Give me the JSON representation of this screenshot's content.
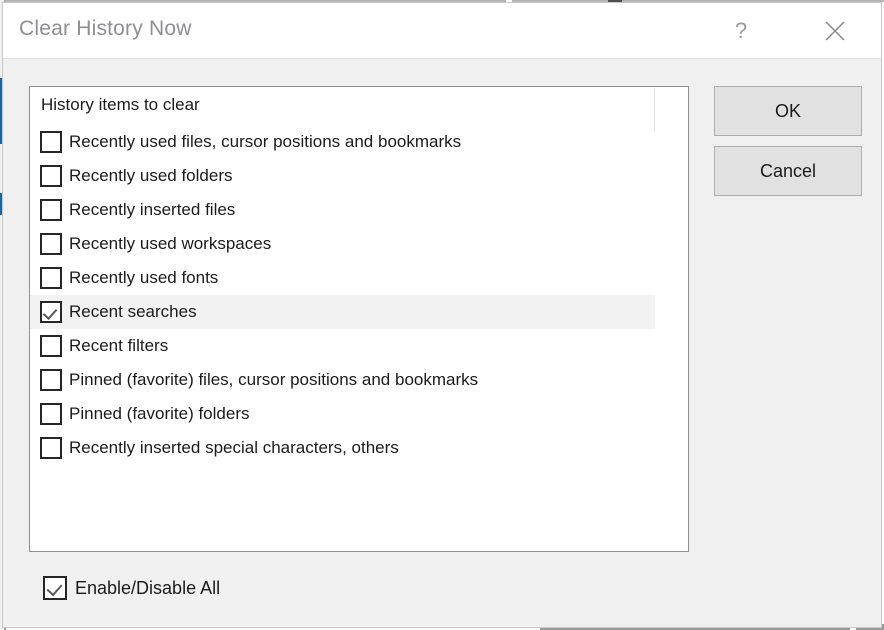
{
  "dialog": {
    "title": "Clear History Now",
    "help_icon": "question-mark-icon",
    "close_icon": "close-x-icon"
  },
  "list": {
    "header": "History items to clear",
    "items": [
      {
        "label": "Recently used files, cursor positions and bookmarks",
        "checked": false,
        "selected": false
      },
      {
        "label": "Recently used folders",
        "checked": false,
        "selected": false
      },
      {
        "label": "Recently inserted files",
        "checked": false,
        "selected": false
      },
      {
        "label": "Recently used workspaces",
        "checked": false,
        "selected": false
      },
      {
        "label": "Recently used fonts",
        "checked": false,
        "selected": false
      },
      {
        "label": "Recent searches",
        "checked": true,
        "selected": true
      },
      {
        "label": "Recent filters",
        "checked": false,
        "selected": false
      },
      {
        "label": "Pinned (favorite) files, cursor positions and bookmarks",
        "checked": false,
        "selected": false
      },
      {
        "label": "Pinned (favorite) folders",
        "checked": false,
        "selected": false
      },
      {
        "label": "Recently inserted special characters, others",
        "checked": false,
        "selected": false
      }
    ]
  },
  "enable_all": {
    "label": "Enable/Disable All",
    "checked": true
  },
  "buttons": {
    "ok": "OK",
    "cancel": "Cancel"
  },
  "colors": {
    "accent": "#1565a8",
    "dialog_background": "#f0f0f0",
    "title_text": "#8e8e93",
    "selection": "#f2f2f2",
    "button_face": "#e1e1e1"
  }
}
